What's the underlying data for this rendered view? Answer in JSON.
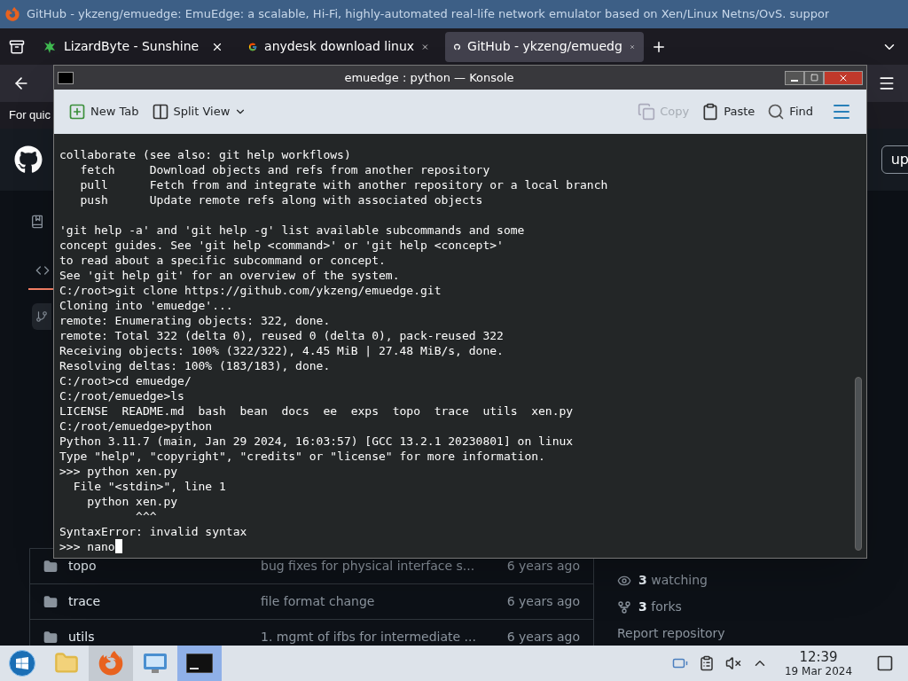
{
  "browser": {
    "window_title": "GitHub - ykzeng/emuedge: EmuEdge: a scalable, Hi-Fi, highly-automated real-life network emulator based on Xen/Linux Netns/OvS. suppor",
    "tabs": [
      {
        "label": "LizardByte - Sunshine",
        "selected": false
      },
      {
        "label": "anydesk download linux",
        "selected": false
      },
      {
        "label": "GitHub - ykzeng/emuedg",
        "selected": true
      }
    ],
    "notice": "For quic",
    "header_button": "up",
    "files": [
      {
        "name": "topo",
        "message": "bug fixes for physical interface s...",
        "age": "6 years ago"
      },
      {
        "name": "trace",
        "message": "file format change",
        "age": "6 years ago"
      },
      {
        "name": "utils",
        "message": "1. mgmt of ifbs for intermediate ...",
        "age": "6 years ago"
      }
    ],
    "stats": [
      {
        "kind": "watching",
        "count": "3",
        "label": "watching"
      },
      {
        "kind": "forks",
        "count": "3",
        "label": "forks"
      }
    ],
    "report": "Report repository"
  },
  "konsole": {
    "title": "emuedge : python — Konsole",
    "toolbar": [
      {
        "kind": "newtab",
        "label": "New Tab",
        "disabled": false
      },
      {
        "kind": "split",
        "label": "Split View",
        "disabled": false
      },
      {
        "kind": "copy",
        "label": "Copy",
        "disabled": true
      },
      {
        "kind": "paste",
        "label": "Paste",
        "disabled": false
      },
      {
        "kind": "find",
        "label": "Find",
        "disabled": false
      }
    ],
    "blocks": [
      [
        "collaborate (see also: git help workflows)",
        "   fetch     Download objects and refs from another repository",
        "   pull      Fetch from and integrate with another repository or a local branch",
        "   push      Update remote refs along with associated objects"
      ],
      [
        "'git help -a' and 'git help -g' list available subcommands and some",
        "concept guides. See 'git help <command>' or 'git help <concept>'",
        "to read about a specific subcommand or concept.",
        "See 'git help git' for an overview of the system.",
        "C:/root>git clone https://github.com/ykzeng/emuedge.git",
        "Cloning into 'emuedge'...",
        "remote: Enumerating objects: 322, done.",
        "remote: Total 322 (delta 0), reused 0 (delta 0), pack-reused 322",
        "Receiving objects: 100% (322/322), 4.45 MiB | 27.48 MiB/s, done.",
        "Resolving deltas: 100% (183/183), done.",
        "C:/root>cd emuedge/",
        "C:/root/emuedge>ls",
        "LICENSE  README.md  bash  bean  docs  ee  exps  topo  trace  utils  xen.py",
        "C:/root/emuedge>python",
        "Python 3.11.7 (main, Jan 29 2024, 16:03:57) [GCC 13.2.1 20230801] on linux",
        "Type \"help\", \"copyright\", \"credits\" or \"license\" for more information.",
        ">>> python xen.py",
        "  File \"<stdin>\", line 1",
        "    python xen.py",
        "           ^^^",
        "SyntaxError: invalid syntax",
        ">>> nano"
      ]
    ],
    "cursor": true
  },
  "taskbar": {
    "apps": [
      {
        "kind": "start",
        "selected": false
      },
      {
        "kind": "files",
        "selected": false
      },
      {
        "kind": "firefox",
        "selected": true
      },
      {
        "kind": "settings",
        "selected": false
      },
      {
        "kind": "terminal",
        "selected": true
      }
    ],
    "time": "12:39",
    "date": "19 Mar 2024"
  }
}
